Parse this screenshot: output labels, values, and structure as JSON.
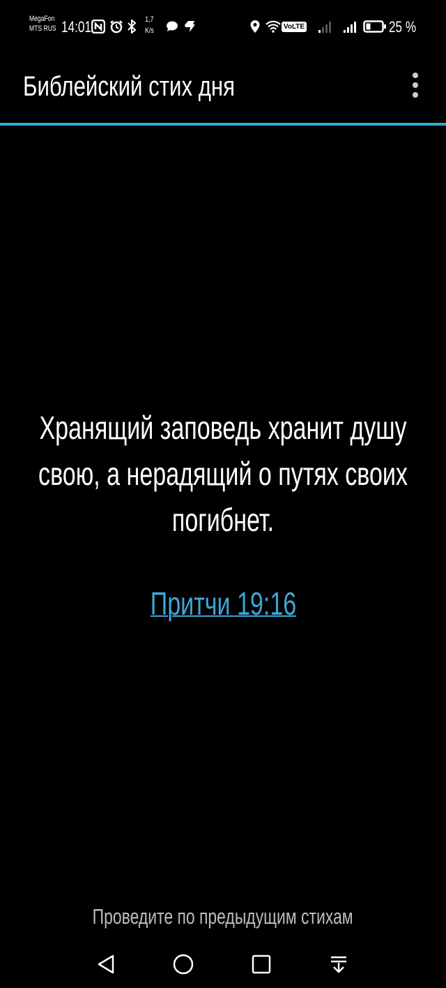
{
  "status_bar": {
    "carrier1": "MegaFon",
    "carrier2": "MTS RUS",
    "time": "14:01",
    "net_speed_value": "1,7",
    "net_speed_unit": "K/s",
    "volte": "VoLTE",
    "battery_percent": "25 %",
    "battery_level": 0.25,
    "icons": [
      "nfc-icon",
      "alarm-icon",
      "bluetooth-icon",
      "chat-icon",
      "app-notification-icon",
      "location-icon",
      "wifi-icon",
      "volte-icon",
      "signal-weak-icon",
      "signal-strong-icon",
      "battery-icon"
    ]
  },
  "app_bar": {
    "title": "Библейский стих дня",
    "menu_icon": "more-vert-icon",
    "accent_color": "#3ea6d8"
  },
  "verse": {
    "text": "Хранящий заповедь хранит душу свою, а нерадящий о путях своих погибнет.",
    "reference": "Притчи 19:16"
  },
  "hint": {
    "text": "Проведите по предыдущим стихам"
  },
  "nav_bar": {
    "icons": [
      "back-icon",
      "home-icon",
      "recents-icon",
      "notification-shade-icon"
    ]
  }
}
